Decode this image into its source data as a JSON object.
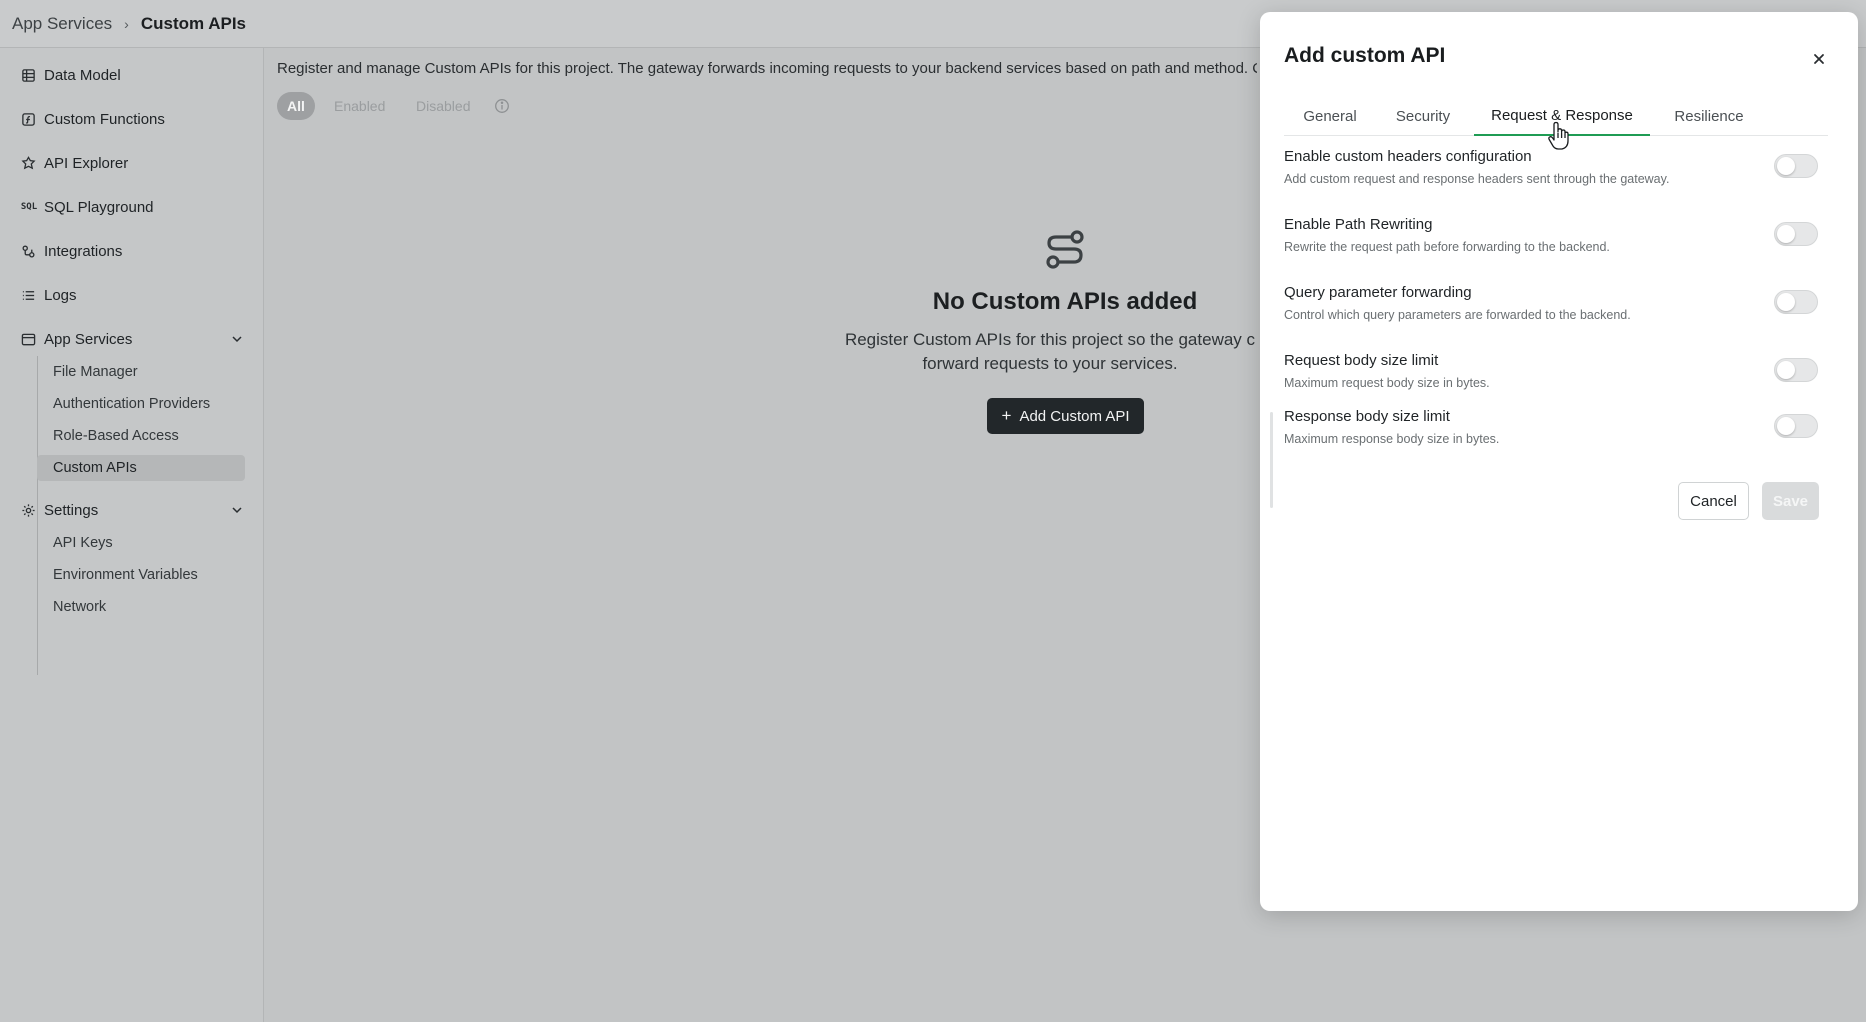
{
  "breadcrumb": {
    "parent": "App Services",
    "current": "Custom APIs"
  },
  "sidebar": {
    "items": [
      {
        "label": "Data Model",
        "icon": "table-icon"
      },
      {
        "label": "Custom Functions",
        "icon": "function-icon"
      },
      {
        "label": "API Explorer",
        "icon": "explorer-icon"
      },
      {
        "label": "SQL Playground",
        "icon": "sql-icon",
        "icon_text": "SQL"
      },
      {
        "label": "Integrations",
        "icon": "integrations-icon"
      },
      {
        "label": "Logs",
        "icon": "list-icon"
      }
    ],
    "app_services": {
      "label": "App Services",
      "children": [
        "File Manager",
        "Authentication Providers",
        "Role-Based Access",
        "Custom APIs"
      ]
    },
    "settings": {
      "label": "Settings",
      "children": [
        "API Keys",
        "Environment Variables",
        "Network"
      ]
    }
  },
  "main": {
    "description": "Register and manage Custom APIs for this project. The gateway forwards incoming requests to your backend services based on path and method. C",
    "filters": [
      "All",
      "Enabled",
      "Disabled"
    ],
    "empty_state": {
      "title": "No Custom APIs added",
      "text_line1": "Register Custom APIs for this project so the gateway c",
      "text_line2": "forward requests to your services.",
      "button_label": "Add Custom API"
    }
  },
  "modal": {
    "title": "Add custom API",
    "tabs": [
      "General",
      "Security",
      "Request & Response",
      "Resilience"
    ],
    "active_tab": "Request & Response",
    "settings": [
      {
        "title": "Enable custom headers configuration",
        "description": "Add custom request and response headers sent through the gateway.",
        "enabled": false
      },
      {
        "title": "Enable Path Rewriting",
        "description": "Rewrite the request path before forwarding to the backend.",
        "enabled": false
      },
      {
        "title": "Query parameter forwarding",
        "description": "Control which query parameters are forwarded to the backend.",
        "enabled": false
      },
      {
        "title": "Request body size limit",
        "description": "Maximum request body size in bytes.",
        "enabled": false
      },
      {
        "title": "Response body size limit",
        "description": "Maximum response body size in bytes.",
        "enabled": false
      }
    ],
    "cancel_label": "Cancel",
    "save_label": "Save"
  },
  "colors": {
    "active_tab_underline": "#1f9c54",
    "primary_button": "#22272a",
    "overlay_background": "#c2c4c5"
  }
}
